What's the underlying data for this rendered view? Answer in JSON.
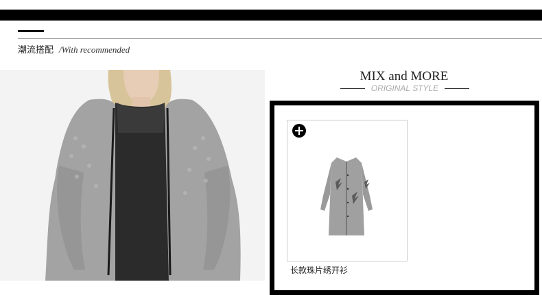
{
  "section": {
    "title_cn": "潮流搭配",
    "title_en": "/With recommended"
  },
  "mix": {
    "title": "MIX and MORE",
    "subtitle": "ORIGINAL STYLE"
  },
  "product": {
    "name": "长款珠片绣开衫",
    "add_icon": "plus-circle-icon"
  },
  "colors": {
    "topbar": "#000000",
    "subtitle": "#aaaaaa",
    "cardigan": "#9a9a9a"
  }
}
